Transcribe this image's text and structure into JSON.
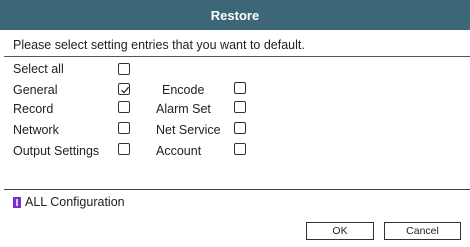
{
  "dialog": {
    "title": "Restore",
    "prompt": "Please select setting entries that you want to default."
  },
  "options": {
    "select_all": {
      "label": "Select all",
      "checked": false
    },
    "general": {
      "label": "General",
      "checked": true
    },
    "encode": {
      "label": "Encode",
      "checked": false
    },
    "record": {
      "label": "Record",
      "checked": false
    },
    "alarm_set": {
      "label": "Alarm Set",
      "checked": false
    },
    "network": {
      "label": "Network",
      "checked": false
    },
    "net_service": {
      "label": "Net Service",
      "checked": false
    },
    "output_settings": {
      "label": "Output Settings",
      "checked": false
    },
    "account": {
      "label": "Account",
      "checked": false
    }
  },
  "footer": {
    "all_configuration_label": "ALL Configuration",
    "icon": "info-icon",
    "icon_color": "#7a2fd0"
  },
  "buttons": {
    "ok_label": "OK",
    "cancel_label": "Cancel"
  },
  "colors": {
    "titlebar": "#3d6778"
  }
}
